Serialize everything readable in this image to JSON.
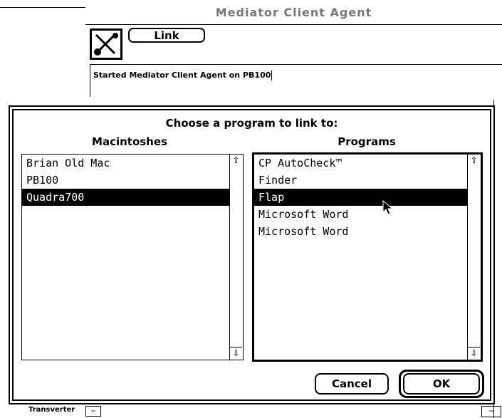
{
  "agent_window": {
    "title": "Mediator Client Agent",
    "link_button": "Link",
    "status_text": "Started Mediator Client Agent on PB100"
  },
  "dialog": {
    "prompt": "Choose a program to link to:",
    "macintoshes": {
      "header": "Macintoshes",
      "items": [
        "Brian Old Mac",
        "PB100",
        "Quadra700"
      ],
      "selected_index": 2
    },
    "programs": {
      "header": "Programs",
      "items": [
        "CP AutoCheck™",
        "Finder",
        "Flap",
        "Microsoft Word",
        "Microsoft Word"
      ],
      "selected_index": 2
    },
    "cancel_button": "Cancel",
    "ok_button": "OK"
  },
  "background": {
    "bottom_label": "Transverter"
  },
  "icons": {
    "agent": "satellite-link-icon",
    "scroll_up": "scroll-up-arrow-icon",
    "scroll_down": "scroll-down-arrow-icon",
    "cursor": "arrow-cursor-icon"
  },
  "colors": {
    "selection": "#000000",
    "background": "#ffffff",
    "title_text": "#777777"
  }
}
